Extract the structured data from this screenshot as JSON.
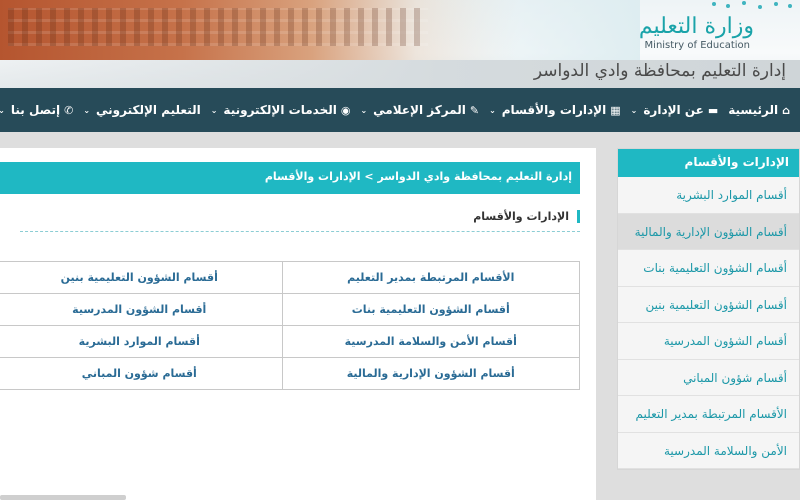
{
  "header": {
    "logo_arabic": "وزارة التعليم",
    "logo_english": "Ministry of Education",
    "directorate_title": "إدارة التعليم بمحافظة وادي الدواسر"
  },
  "nav": {
    "items": [
      {
        "label": "الرئيسية",
        "icon": "home-icon",
        "glyph": "⌂",
        "has_dropdown": false
      },
      {
        "label": "عن الإدارة",
        "icon": "monitor-icon",
        "glyph": "▬",
        "has_dropdown": true
      },
      {
        "label": "الإدارات والأقسام",
        "icon": "grid-icon",
        "glyph": "▦",
        "has_dropdown": true
      },
      {
        "label": "المركز الإعلامي",
        "icon": "edit-icon",
        "glyph": "✎",
        "has_dropdown": true
      },
      {
        "label": "الخدمات الإلكترونية",
        "icon": "globe-icon",
        "glyph": "◉",
        "has_dropdown": true
      },
      {
        "label": "التعليم الإلكتروني",
        "icon": "",
        "glyph": "",
        "has_dropdown": true
      },
      {
        "label": "إتصل بنا",
        "icon": "phone-icon",
        "glyph": "✆",
        "has_dropdown": true
      }
    ],
    "caret": "⌄"
  },
  "breadcrumb": {
    "text": "إدارة التعليم بمحافظة وادي الدواسر > الإدارات والأقسام"
  },
  "section": {
    "heading": "الإدارات والأقسام"
  },
  "departments_table": {
    "rows": [
      [
        "الأقسام المرتبطة بمدير التعليم",
        "أقسام الشؤون التعليمية بنين"
      ],
      [
        "أقسام الشؤون التعليمية بنات",
        "أقسام الشؤون المدرسية"
      ],
      [
        "أقسام الأمن والسلامة المدرسية",
        "أقسام الموارد البشرية"
      ],
      [
        "أقسام الشؤون الإدارية والمالية",
        "أقسام شؤون المباني"
      ]
    ]
  },
  "sidebar": {
    "header": "الإدارات والأقسام",
    "items": [
      {
        "label": "أقسام الموارد البشرية",
        "active": false
      },
      {
        "label": "أقسام الشؤون الإدارية والمالية",
        "active": true
      },
      {
        "label": "أقسام الشؤون التعليمية بنات",
        "active": false
      },
      {
        "label": "أقسام الشؤون التعليمية بنين",
        "active": false
      },
      {
        "label": "أقسام الشؤون المدرسية",
        "active": false
      },
      {
        "label": "أقسام شؤون المباني",
        "active": false
      },
      {
        "label": "الأقسام المرتبطة بمدير التعليم",
        "active": false
      },
      {
        "label": "الأمن والسلامة المدرسية",
        "active": false
      }
    ]
  },
  "colors": {
    "nav_bg": "#274b59",
    "accent_teal": "#1fb8c3",
    "link_blue": "#2a6b95",
    "sidebar_link": "#1c98a8"
  }
}
